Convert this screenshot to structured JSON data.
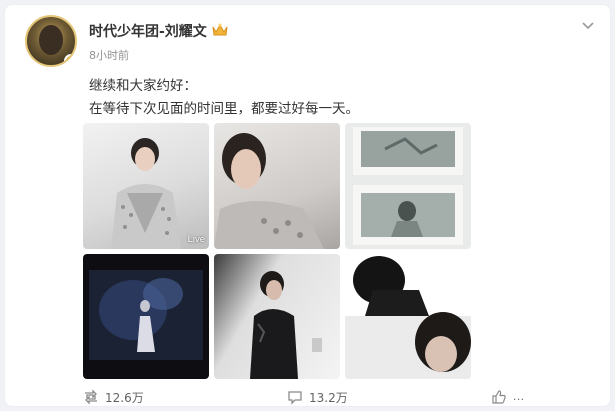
{
  "post": {
    "author": "时代少年团-刘耀文",
    "time": "8小时前",
    "lines": [
      "继续和大家约好：",
      "在等待下次见面的时间里，都要过好每一天。"
    ],
    "images": [
      {
        "name": "photo-1",
        "badge": "Live"
      },
      {
        "name": "photo-2",
        "badge": ""
      },
      {
        "name": "photo-3",
        "badge": ""
      },
      {
        "name": "photo-4",
        "badge": ""
      },
      {
        "name": "photo-5",
        "badge": ""
      },
      {
        "name": "photo-6",
        "badge": ""
      }
    ]
  },
  "actions": {
    "repost_count": "12.6万",
    "comment_count": "13.2万",
    "like_count": "...",
    "repost_icon": "repost-icon",
    "comment_icon": "comment-icon",
    "like_icon": "like-icon"
  },
  "colors": {
    "accent_badge": "#f5a623",
    "text_main": "#333333",
    "text_muted": "#939393"
  }
}
